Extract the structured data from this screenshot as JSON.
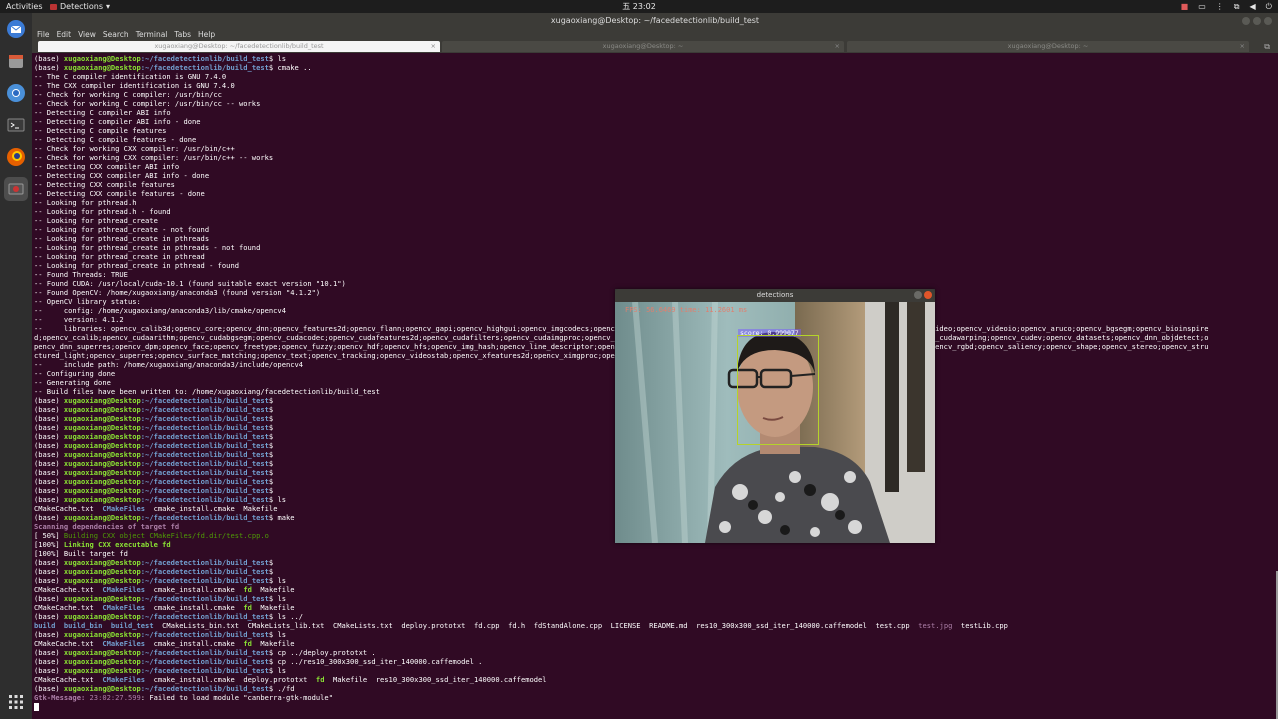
{
  "topbar": {
    "activities": "Activities",
    "app_menu": "Detections",
    "clock": "五 23:02"
  },
  "dock": {
    "apps": [
      "thunderbird-icon",
      "files-icon",
      "chromium-icon",
      "terminal-icon",
      "firefox-icon",
      "camera-app-icon"
    ]
  },
  "terminal": {
    "title": "xugaoxiang@Desktop: ~/facedetectionlib/build_test",
    "menu": [
      "File",
      "Edit",
      "View",
      "Search",
      "Terminal",
      "Tabs",
      "Help"
    ],
    "tabs": [
      {
        "label": "xugaoxiang@Desktop: ~/facedetectionlib/build_test"
      },
      {
        "label": "xugaoxiang@Desktop: ~"
      },
      {
        "label": "xugaoxiang@Desktop: ~"
      }
    ],
    "prompt": {
      "env": "(base) ",
      "user": "xugaoxiang@Desktop",
      "path": ":~/facedetectionlib/build_test",
      "sign": "$ "
    },
    "lines": [
      {
        "cmd": "ls"
      },
      {
        "cmd": "cmake .."
      },
      "-- The C compiler identification is GNU 7.4.0",
      "-- The CXX compiler identification is GNU 7.4.0",
      "-- Check for working C compiler: /usr/bin/cc",
      "-- Check for working C compiler: /usr/bin/cc -- works",
      "-- Detecting C compiler ABI info",
      "-- Detecting C compiler ABI info - done",
      "-- Detecting C compile features",
      "-- Detecting C compile features - done",
      "-- Check for working CXX compiler: /usr/bin/c++",
      "-- Check for working CXX compiler: /usr/bin/c++ -- works",
      "-- Detecting CXX compiler ABI info",
      "-- Detecting CXX compiler ABI info - done",
      "-- Detecting CXX compile features",
      "-- Detecting CXX compile features - done",
      "-- Looking for pthread.h",
      "-- Looking for pthread.h - found",
      "-- Looking for pthread_create",
      "-- Looking for pthread_create - not found",
      "-- Looking for pthread_create in pthreads",
      "-- Looking for pthread_create in pthreads - not found",
      "-- Looking for pthread_create in pthread",
      "-- Looking for pthread_create in pthread - found",
      "-- Found Threads: TRUE",
      "-- Found CUDA: /usr/local/cuda-10.1 (found suitable exact version \"10.1\")",
      "-- Found OpenCV: /home/xugaoxiang/anaconda3 (found version \"4.1.2\")",
      "-- OpenCV library status:",
      "--     config: /home/xugaoxiang/anaconda3/lib/cmake/opencv4",
      "--     version: 4.1.2",
      "--     libraries: opencv_calib3d;opencv_core;opencv_dnn;opencv_features2d;opencv_flann;opencv_gapi;opencv_highgui;opencv_imgcodecs;opencv_imgproc;opencv_ml;opencv_objdetect;opencv_photo;opencv_stitching;opencv_video;opencv_videoio;opencv_aruco;opencv_bgsegm;opencv_bioinspire",
      "d;opencv_ccalib;opencv_cudaarithm;opencv_cudabgsegm;opencv_cudacodec;opencv_cudafeatures2d;opencv_cudafilters;opencv_cudaimgproc;opencv_cudalegacy;opencv_cudaobjdetect;opencv_cudaoptflow;opencv_cudastereo;opencv_cudawarping;opencv_cudev;opencv_datasets;opencv_dnn_objdetect;o",
      "pencv_dnn_superres;opencv_dpm;opencv_face;opencv_freetype;opencv_fuzzy;opencv_hdf;opencv_hfs;opencv_img_hash;opencv_line_descriptor;opencv_optflow;opencv_phase_unwrapping;opencv_plot;opencv_quality;opencv_reg;opencv_rgbd;opencv_saliency;opencv_shape;opencv_stereo;opencv_stru",
      "ctured_light;opencv_superres;opencv_surface_matching;opencv_text;opencv_tracking;opencv_videostab;opencv_xfeatures2d;opencv_ximgproc;opencv_xobjdetect;opencv_xphoto",
      "--     include path: /home/xugaoxiang/anaconda3/include/opencv4",
      "-- Configuring done",
      "-- Generating done",
      "-- Build files have been written to: /home/xugaoxiang/facedetectionlib/build_test",
      {
        "cmd": ""
      },
      {
        "cmd": ""
      },
      {
        "cmd": ""
      },
      {
        "cmd": ""
      },
      {
        "cmd": ""
      },
      {
        "cmd": ""
      },
      {
        "cmd": ""
      },
      {
        "cmd": ""
      },
      {
        "cmd": ""
      },
      {
        "cmd": ""
      },
      {
        "cmd": ""
      },
      {
        "cmd": "ls"
      },
      {
        "ls": [
          [
            "CMakeCache.txt",
            ""
          ],
          [
            "CMakeFiles",
            "b"
          ],
          [
            "cmake_install.cmake",
            ""
          ],
          [
            "Makefile",
            ""
          ]
        ]
      },
      {
        "cmd": "make"
      },
      {
        "text": "Scanning dependencies of target fd",
        "cls": "mb"
      },
      {
        "parts": [
          [
            "[ 50%] ",
            ""
          ],
          [
            "Building CXX object CMakeFiles/fd.dir/test.cpp.o",
            "gn"
          ]
        ]
      },
      {
        "parts": [
          [
            "[100%] ",
            ""
          ],
          [
            "Linking CXX executable fd",
            "gb"
          ]
        ]
      },
      "[100%] Built target fd",
      {
        "cmd": ""
      },
      {
        "cmd": ""
      },
      {
        "cmd": "ls"
      },
      {
        "ls": [
          [
            "CMakeCache.txt",
            ""
          ],
          [
            "CMakeFiles",
            "b"
          ],
          [
            "cmake_install.cmake",
            ""
          ],
          [
            "fd",
            "g"
          ],
          [
            "Makefile",
            ""
          ]
        ]
      },
      {
        "cmd": "ls"
      },
      {
        "ls": [
          [
            "CMakeCache.txt",
            ""
          ],
          [
            "CMakeFiles",
            "b"
          ],
          [
            "cmake_install.cmake",
            ""
          ],
          [
            "fd",
            "g"
          ],
          [
            "Makefile",
            ""
          ]
        ]
      },
      {
        "cmd": "ls ../"
      },
      {
        "ls": [
          [
            "build",
            "b"
          ],
          [
            "build_bin",
            "b"
          ],
          [
            "build_test",
            "b"
          ],
          [
            "CMakeLists_bin.txt",
            ""
          ],
          [
            "CMakeLists_lib.txt",
            ""
          ],
          [
            "CMakeLists.txt",
            ""
          ],
          [
            "deploy.prototxt",
            ""
          ],
          [
            "fd.cpp",
            ""
          ],
          [
            "fd.h",
            ""
          ],
          [
            "fdStandAlone.cpp",
            ""
          ],
          [
            "LICENSE",
            ""
          ],
          [
            "README.md",
            ""
          ],
          [
            "res10_300x300_ssd_iter_140000.caffemodel",
            ""
          ],
          [
            "test.cpp",
            ""
          ],
          [
            "test.jpg",
            "m"
          ],
          [
            "testLib.cpp",
            ""
          ]
        ]
      },
      {
        "cmd": "ls"
      },
      {
        "ls": [
          [
            "CMakeCache.txt",
            ""
          ],
          [
            "CMakeFiles",
            "b"
          ],
          [
            "cmake_install.cmake",
            ""
          ],
          [
            "fd",
            "g"
          ],
          [
            "Makefile",
            ""
          ]
        ]
      },
      {
        "cmd": "cp ../deploy.prototxt ."
      },
      {
        "cmd": "cp ../res10_300x300_ssd_iter_140000.caffemodel ."
      },
      {
        "cmd": "ls"
      },
      {
        "ls": [
          [
            "CMakeCache.txt",
            ""
          ],
          [
            "CMakeFiles",
            "b"
          ],
          [
            "cmake_install.cmake",
            ""
          ],
          [
            "deploy.prototxt",
            ""
          ],
          [
            "fd",
            "g"
          ],
          [
            "Makefile",
            ""
          ],
          [
            "res10_300x300_ssd_iter_140000.caffemodel",
            ""
          ]
        ]
      },
      {
        "cmd": "./fd"
      },
      {
        "parts": [
          [
            "Gtk-Message: ",
            "mb"
          ],
          [
            "23:02:27.599",
            "m"
          ],
          [
            ": Failed to load module \"canberra-gtk-module\"",
            ""
          ]
        ]
      },
      {
        "cursor": true
      }
    ]
  },
  "detections": {
    "title": "detections",
    "fps_text": "FPS: 56.6469   time: 11.2601 ms",
    "confidence": "score: 0.999077"
  }
}
